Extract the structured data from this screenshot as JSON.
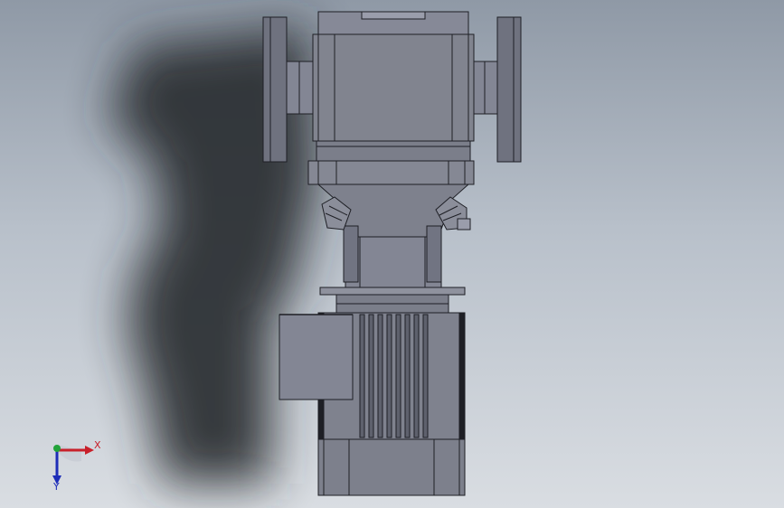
{
  "viewport": {
    "background_top": "#8f99a6",
    "background_bottom": "#d9dde2",
    "part_color": "#7c7f8d",
    "edge_color": "#1e1f25",
    "shadow_color": "#2b2e33"
  },
  "triad": {
    "x_label": "X",
    "y_label": "Y",
    "x_color": "#c8202a",
    "y_color": "#1d2db8",
    "z_color": "#22a33a"
  }
}
